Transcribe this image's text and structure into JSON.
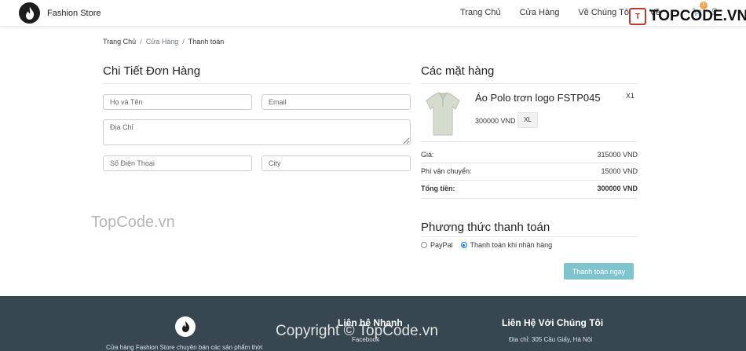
{
  "nav": {
    "brand": "Fashion Store",
    "links": [
      "Trang Chủ",
      "Cửa Hàng",
      "Về Chúng Tôi",
      "Về"
    ],
    "cart_count": "1"
  },
  "watermark": {
    "top": "TOPCODE.VN",
    "middle": "TopCode.vn",
    "bottom": "Copyright © TopCode.vn"
  },
  "breadcrumb": {
    "home": "Trang Chủ",
    "shop": "Cửa Hàng",
    "current": "Thanh toán"
  },
  "order": {
    "title": "Chi Tiết Đơn Hàng",
    "fields": {
      "name_placeholder": "Họ và Tên",
      "email_placeholder": "Email",
      "address_placeholder": "Địa Chỉ",
      "phone_placeholder": "Số Điện Thoại",
      "city_placeholder": "City"
    }
  },
  "items": {
    "title": "Các mặt hàng",
    "product": {
      "name": "Áo Polo trơn logo FSTP045",
      "quantity": "X1",
      "price": "300000 VND",
      "size": "XL"
    },
    "summary": [
      {
        "label": "Giá:",
        "value": "315000 VND"
      },
      {
        "label": "Phí vận chuyển:",
        "value": "15000 VND"
      },
      {
        "label": "Tổng tiền:",
        "value": "300000 VND"
      }
    ]
  },
  "payment": {
    "title": "Phương thức thanh toán",
    "options": [
      "PayPal",
      "Thanh toán khi nhận hàng"
    ],
    "selected": "Thanh toán khi nhận hàng",
    "button": "Thanh toán ngay"
  },
  "footer": {
    "description": "Cửa hàng Fashion Store chuyên bán các sản phẩm thời",
    "quick_title": "Liên hệ Nhanh",
    "quick_link": "Facebook",
    "contact_title": "Liên Hệ Với Chúng Tôi",
    "address": "Địa chỉ: 305 Cầu Giấy, Hà Nội"
  }
}
